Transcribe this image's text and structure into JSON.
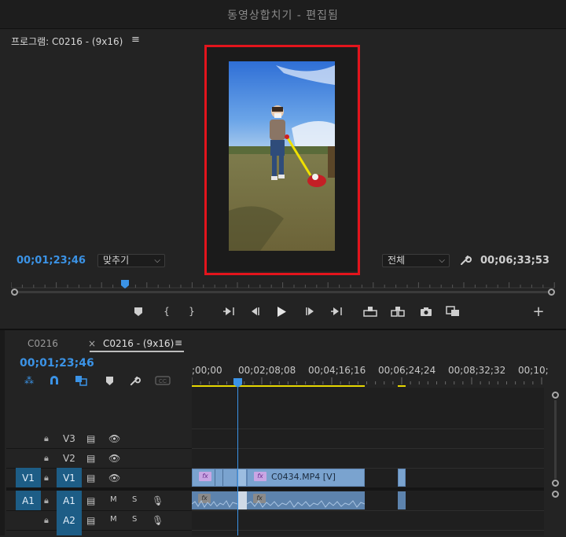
{
  "window": {
    "title": "동영상합치기 - 편집됨"
  },
  "program_monitor": {
    "title": "프로그램: C0216 - (9x16)",
    "menu_glyph": "≡",
    "current_timecode": "00;01;23;46",
    "zoom_select": "맞추기",
    "quality_select": "전체",
    "duration_timecode": "00;06;33;53"
  },
  "timeline": {
    "tabs": [
      {
        "label": "C0216",
        "active": false
      },
      {
        "label": "C0216 - (9x16)",
        "active": true,
        "close": "×",
        "menu": "≡"
      }
    ],
    "timecode": "00;01;23;46",
    "ruler_labels": [
      ";00;00",
      "00;02;08;08",
      "00;04;16;16",
      "00;06;24;24",
      "00;08;32;32",
      "00;10;"
    ],
    "tracks": [
      {
        "name": "V3",
        "kind": "video"
      },
      {
        "name": "V2",
        "kind": "video"
      },
      {
        "name": "V1",
        "kind": "video",
        "source": "V1"
      },
      {
        "name": "A1",
        "kind": "audio",
        "source": "A1",
        "m": "M",
        "s": "S"
      },
      {
        "name": "A2",
        "kind": "audio",
        "m": "M",
        "s": "S"
      }
    ],
    "clip_label": "C0434.MP4 [V]",
    "fx_label": "fx"
  },
  "colors": {
    "accent_blue": "#3b93e6",
    "highlight_red": "#e3141c",
    "clip_video": "#7aa3cf",
    "clip_audio": "#5d83ad",
    "track_target": "#1d5d86",
    "work_area": "#e6d700"
  }
}
